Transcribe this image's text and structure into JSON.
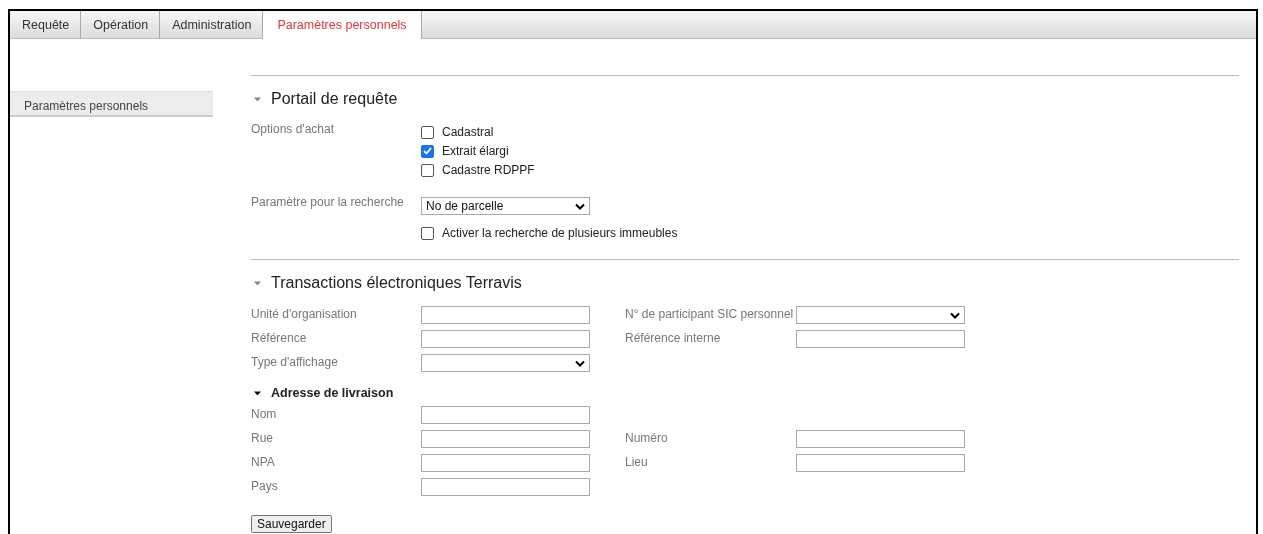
{
  "tabs": [
    {
      "label": "Requête",
      "selected": false
    },
    {
      "label": "Opération",
      "selected": false
    },
    {
      "label": "Administration",
      "selected": false
    },
    {
      "label": "Paramètres personnels",
      "selected": true
    }
  ],
  "sidebar": {
    "items": [
      {
        "label": "Paramètres personnels",
        "selected": true
      }
    ]
  },
  "portal": {
    "title": "Portail de requête",
    "expanded": true,
    "purchase_options": {
      "label": "Options d'achat",
      "options": [
        {
          "label": "Cadastral",
          "checked": false
        },
        {
          "label": "Extrait élargi",
          "checked": true
        },
        {
          "label": "Cadastre RDPPF",
          "checked": false
        }
      ]
    },
    "search_parameter": {
      "label": "Paramètre pour la recherche",
      "value": "No de parcelle"
    },
    "multi_search": {
      "label": "Activer la recherche de plusieurs immeubles",
      "checked": false
    }
  },
  "terravis": {
    "title": "Transactions électroniques Terravis",
    "expanded": true,
    "rows": [
      {
        "left": {
          "label": "Unité d'organisation",
          "kind": "text"
        },
        "right": {
          "label": "N° de participant SIC personnel",
          "kind": "select"
        }
      },
      {
        "left": {
          "label": "Référence",
          "kind": "text"
        },
        "right": {
          "label": "Référence interne",
          "kind": "text"
        }
      },
      {
        "left": {
          "label": "Type d'affichage",
          "kind": "select"
        }
      }
    ],
    "delivery": {
      "title": "Adresse de livraison",
      "expanded": true,
      "rows": [
        {
          "left": {
            "label": "Nom",
            "kind": "text"
          }
        },
        {
          "left": {
            "label": "Rue",
            "kind": "text"
          },
          "right": {
            "label": "Numéro",
            "kind": "text"
          }
        },
        {
          "left": {
            "label": "NPA",
            "kind": "text"
          },
          "right": {
            "label": "Lieu",
            "kind": "text"
          }
        },
        {
          "left": {
            "label": "Pays",
            "kind": "text"
          }
        }
      ]
    }
  },
  "save_button": "Sauvegarder"
}
